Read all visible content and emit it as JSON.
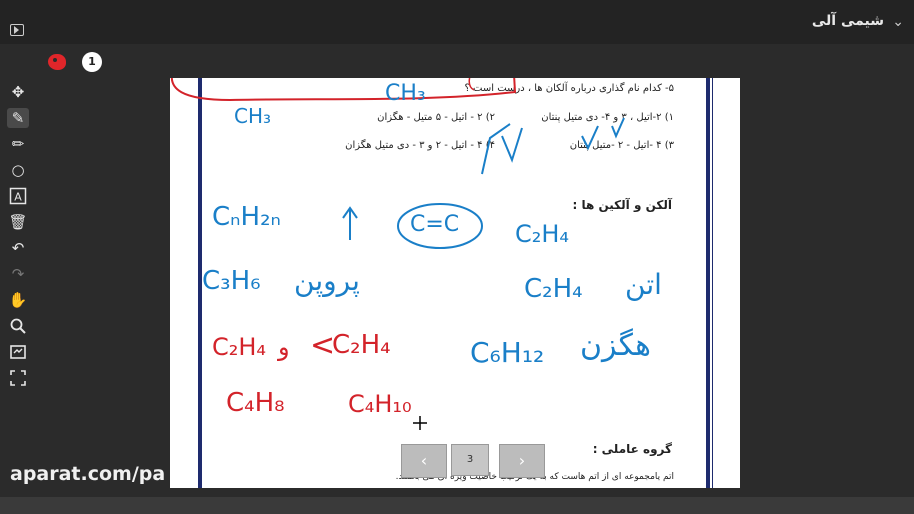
{
  "header": {
    "title": "شیمی آلی",
    "menu_icon": "chevron-down-icon",
    "present_icon": "present-icon"
  },
  "slide_controls": {
    "palette_icon": "palette-icon",
    "page_number": "1"
  },
  "toolbar": {
    "tools": [
      "move-icon",
      "pen-icon",
      "highlighter-icon",
      "circle-icon",
      "text-icon",
      "trash-icon",
      "undo-icon",
      "redo-icon",
      "hand-icon",
      "zoom-icon",
      "fit-screen-icon",
      "fullscreen-icon"
    ]
  },
  "slide": {
    "question": "۵- کدام نام گذاری درباره آلکان ها ، درست است ؟",
    "option1": "۱) ۲-اتیل ، ۳ و ۴- دی متیل پنتان",
    "option2": "۲) ۲ - اتیل - ۵ متیل - هگزان",
    "option3": "۳) ۴ -اتیل - ۲ -متیل پنتان",
    "option4": "۴) ۴ - اتیل - ۲ و ۳ - دی متیل هگزان",
    "heading_alkenes": "آلکن و آلکین ها :",
    "heading_functional": "گروه عاملی :",
    "definition": "اتم یامجموعه ای از اتم هاست که به یک ترکیب خاصیت ویژه ای می بخشد.",
    "handwriting": {
      "ch3_top": "CH₃",
      "ch3_left": "CH₃",
      "cnh2n": "CₙH₂ₙ",
      "arrow": "↑",
      "double_bond": "C=C",
      "c2h4": "C₂H₄",
      "c3h6": "C₃H₆",
      "propene": "پروپن",
      "c2h4b": "C₂H₄",
      "ethene": "اتن",
      "c2h4_red": "C₂H₄",
      "and": "و",
      "lt": "<",
      "c2h4_red2": "C₂H₄",
      "c6h12": "C₆H₁₂",
      "hexene": "هگزن",
      "c4h8": "C₄H₈",
      "c4h10": "C₄H₁₀",
      "blue_color": "#1a7fc8",
      "red_color": "#d3232a"
    }
  },
  "nav": {
    "prev": "‹",
    "page": "3",
    "next": "›"
  },
  "watermark": "aparat.com/pa"
}
